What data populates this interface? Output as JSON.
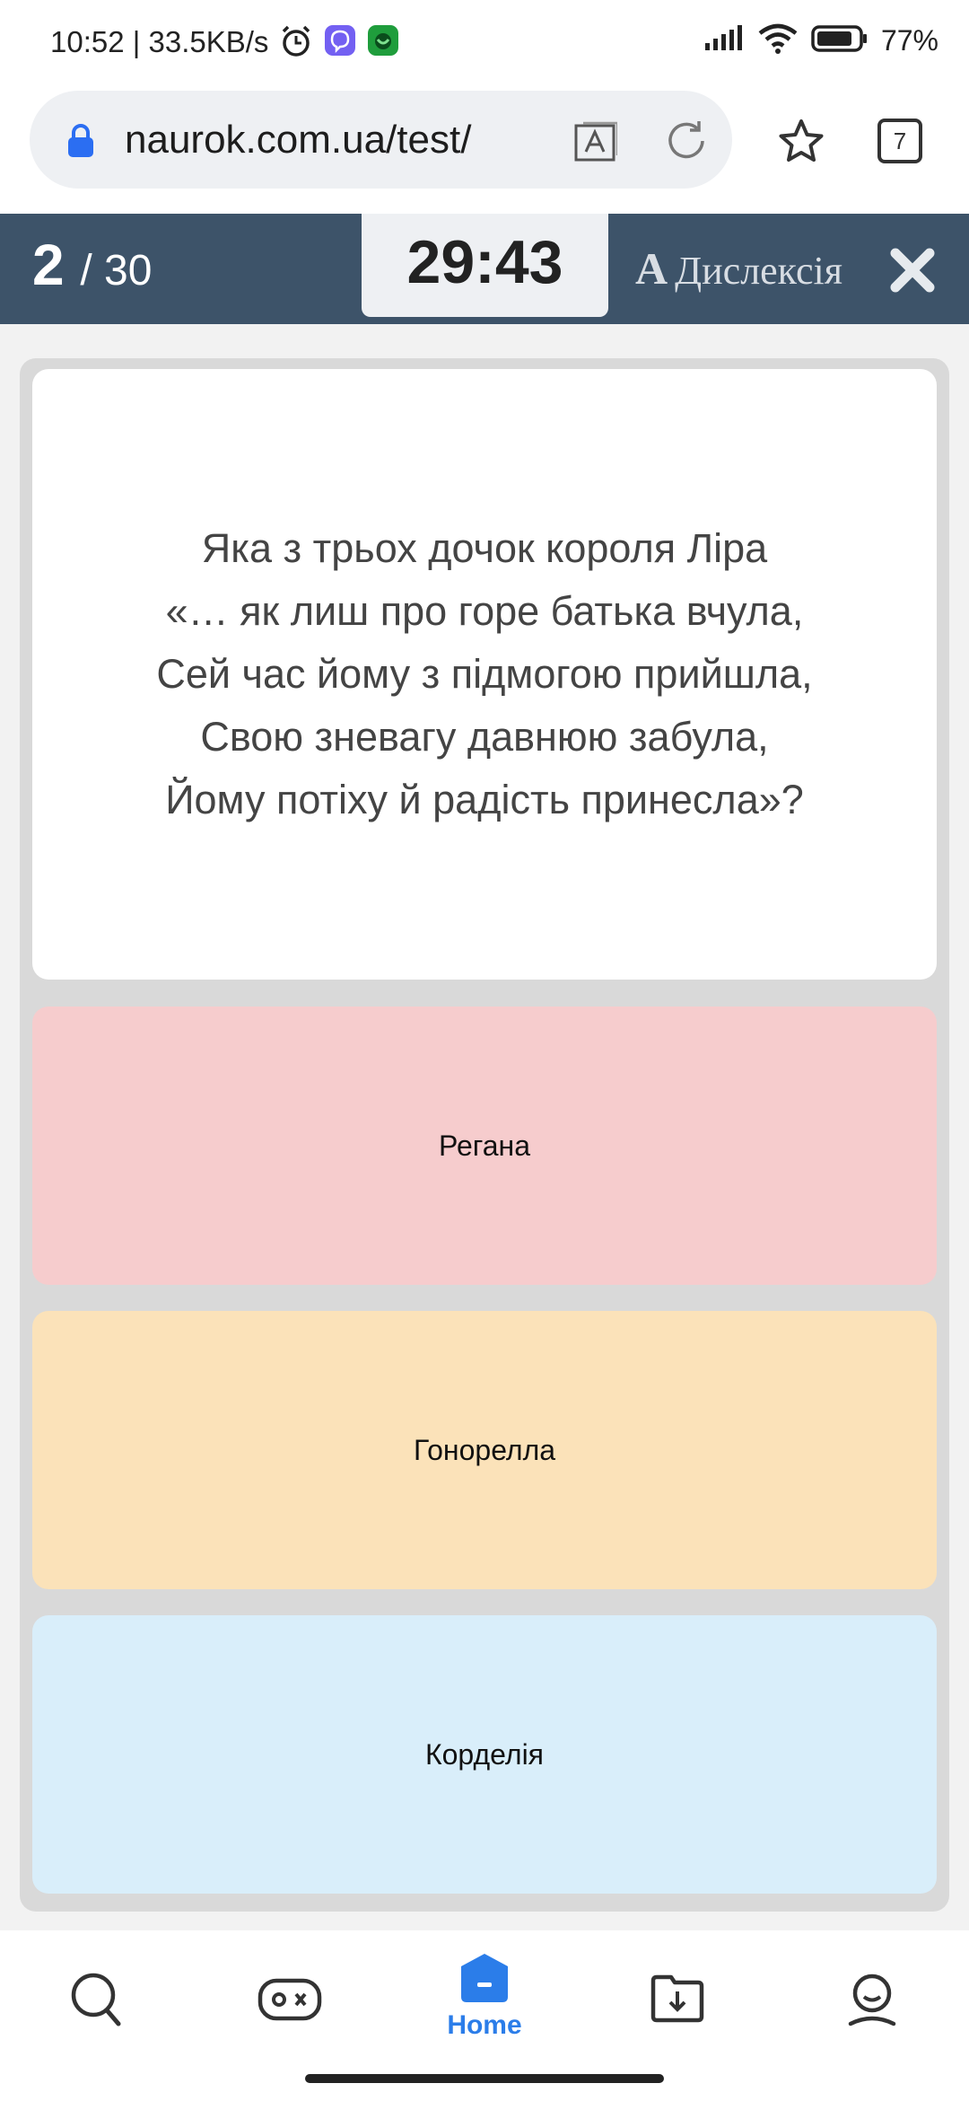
{
  "status_bar": {
    "time_speed": "10:52 | 33.5KB/s",
    "battery_pct": "77%",
    "icons": [
      "alarm-icon",
      "viber-icon",
      "app-icon",
      "signal-icon",
      "wifi-icon",
      "battery-icon"
    ]
  },
  "browser": {
    "url": "naurok.com.ua/test/",
    "tab_count": "7"
  },
  "quiz": {
    "current": "2",
    "total": "/ 30",
    "timer": "29:43",
    "dyslexia_letter": "A",
    "dyslexia_label": "Дислексія",
    "question_lines": [
      "Яка з трьох дочок короля Ліра",
      "«… як лиш про горе батька вчула,",
      "Сей час йому з підмогою прийшла,",
      "Свою зневагу давнюю забула,",
      "Йому потіху й радість принесла»?"
    ],
    "answers": [
      {
        "label": "Регана",
        "color": "#f6cccd"
      },
      {
        "label": "Гонорелла",
        "color": "#fbe2b9"
      },
      {
        "label": "Корделія",
        "color": "#d9eefa"
      }
    ]
  },
  "bottom_nav": {
    "home_label": "Home",
    "accent": "#2b7de9",
    "items": [
      "search-icon",
      "gamepad-icon",
      "home-icon",
      "folder-download-icon",
      "profile-icon"
    ]
  },
  "colors": {
    "header_bg": "#3d5369",
    "content_bg": "#f2f2f2"
  }
}
